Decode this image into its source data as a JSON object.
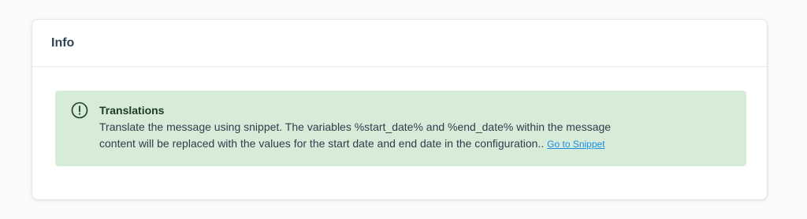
{
  "card": {
    "title": "Info"
  },
  "alert": {
    "icon": "alert-circle-icon",
    "title": "Translations",
    "message_line1": "Translate the message using snippet. The variables %start_date% and %end_date% within the message",
    "message_line2": "content will be replaced with the values for the start date and end date in the configuration.. ",
    "link_label": "Go to Snippet"
  },
  "colors": {
    "page_background": "#f9fafb",
    "card_background": "#ffffff",
    "alert_background": "#d6ecd8",
    "alert_title": "#1c3a24",
    "link": "#1e8fe6"
  }
}
